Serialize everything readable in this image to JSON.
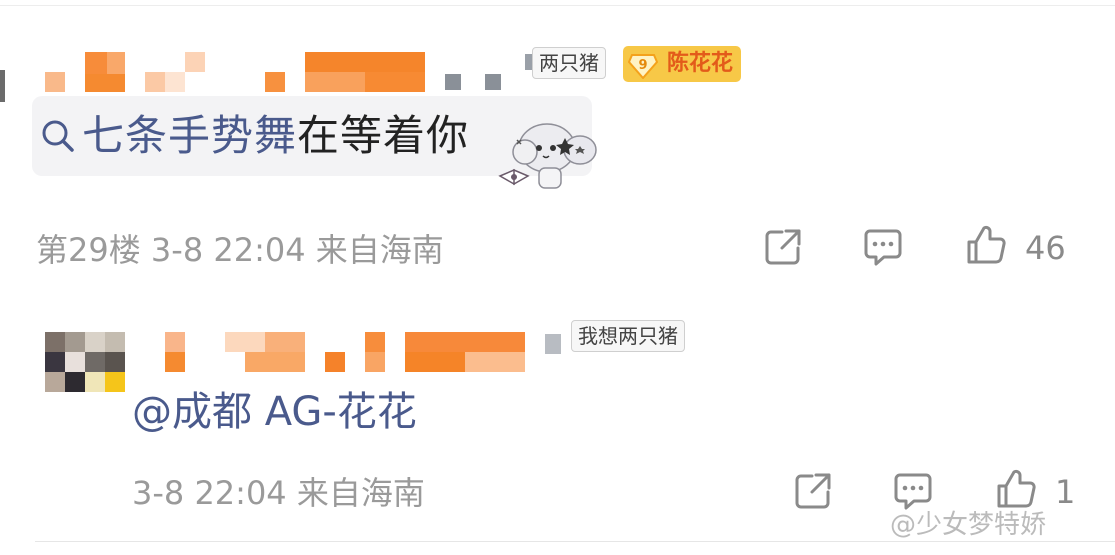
{
  "colors": {
    "link": "#4a5a8c",
    "meta": "#9a9a9a",
    "badge_bg": "#f7c847",
    "badge_text": "#e35b1a",
    "blur_orange": "#f7923a"
  },
  "comment1": {
    "group_tag": "两只猪",
    "fan_badge": {
      "level": "9",
      "name": "陈花花"
    },
    "search_prefix": "七条手势舞",
    "search_suffix": "在等着你",
    "floor": "第29楼",
    "datetime": "3-8 22:04",
    "location": "来自海南",
    "likes": "46",
    "icons": [
      "share-icon",
      "comment-icon",
      "like-icon",
      "search-icon"
    ]
  },
  "comment2": {
    "group_tag": "我想两只猪",
    "mention": "@成都 AG-花花",
    "datetime": "3-8 22:04",
    "location": "来自海南",
    "likes": "1",
    "icons": [
      "share-icon",
      "comment-icon",
      "like-icon"
    ]
  },
  "watermark": "@少女梦特娇"
}
